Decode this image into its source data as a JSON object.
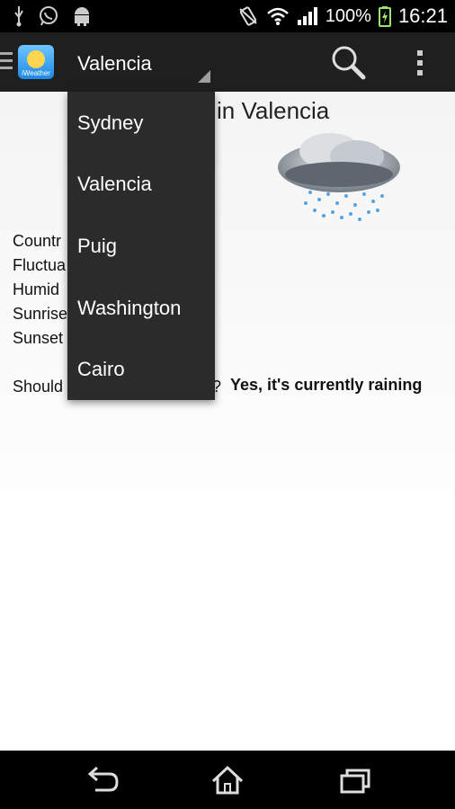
{
  "status_bar": {
    "battery": "100%",
    "time": "16:21"
  },
  "action_bar": {
    "app_icon_label": "iWeather",
    "selected_city": "Valencia"
  },
  "main": {
    "title_visible": "in Valencia",
    "labels": [
      "Countr",
      "Fluctua",
      "Humid",
      "Sunrise",
      "Sunset"
    ],
    "question_visible": "Should",
    "question_tail": "?",
    "answer": "Yes, it's currently raining"
  },
  "dropdown": {
    "items": [
      "Sydney",
      "Valencia",
      "Puig",
      "Washington",
      "Cairo"
    ]
  },
  "colors": {
    "action_bar": "#1f1f1f",
    "dropdown_bg": "#2b2b2b",
    "status_bar": "#000000"
  }
}
